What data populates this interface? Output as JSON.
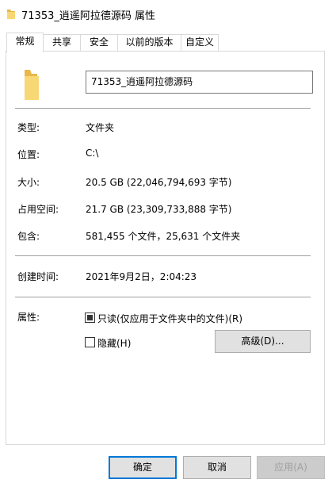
{
  "window": {
    "title": "71353_逍遥阿拉德源码 属性"
  },
  "tabs": [
    {
      "label": "常规"
    },
    {
      "label": "共享"
    },
    {
      "label": "安全"
    },
    {
      "label": "以前的版本"
    },
    {
      "label": "自定义"
    }
  ],
  "general": {
    "folder_name": "71353_逍遥阿拉德源码",
    "type_label": "类型:",
    "type_value": "文件夹",
    "location_label": "位置:",
    "location_value": "C:\\",
    "size_label": "大小:",
    "size_value": "20.5 GB (22,046,794,693 字节)",
    "size_on_disk_label": "占用空间:",
    "size_on_disk_value": "21.7 GB (23,309,733,888 字节)",
    "contains_label": "包含:",
    "contains_value": "581,455 个文件，25,631 个文件夹",
    "created_label": "创建时间:",
    "created_value": "2021年9月2日，2:04:23",
    "attributes_label": "属性:",
    "readonly_label": "只读(仅应用于文件夹中的文件)(R)",
    "hidden_label": "隐藏(H)",
    "advanced_button": "高级(D)..."
  },
  "footer": {
    "ok": "确定",
    "cancel": "取消",
    "apply": "应用(A)"
  },
  "icons": {
    "folder": "folder-icon"
  },
  "colors": {
    "folder": "#f8d775",
    "accent": "#0078d7"
  }
}
